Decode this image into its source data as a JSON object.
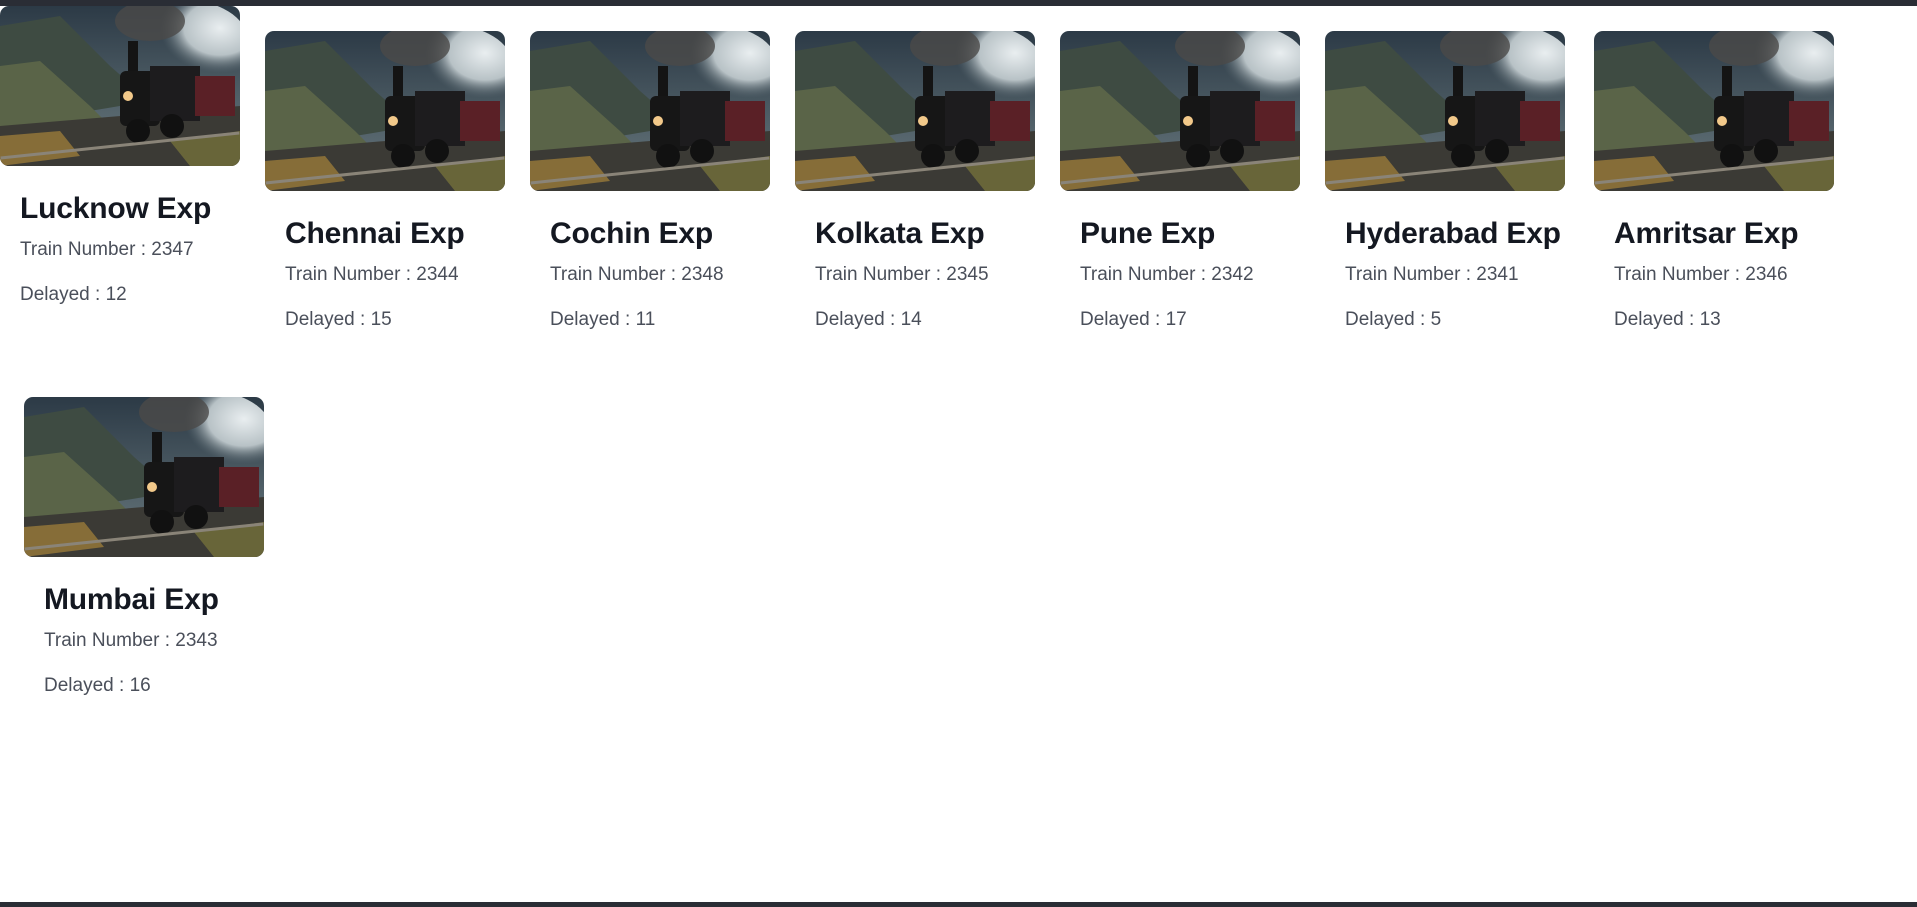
{
  "trains": [
    {
      "name": "Lucknow Exp",
      "number_label": "Train Number",
      "number": "2347",
      "delay_label": "Delayed",
      "delay": "12"
    },
    {
      "name": "Chennai Exp",
      "number_label": "Train Number",
      "number": "2344",
      "delay_label": "Delayed",
      "delay": "15"
    },
    {
      "name": "Cochin Exp",
      "number_label": "Train Number",
      "number": "2348",
      "delay_label": "Delayed",
      "delay": "11"
    },
    {
      "name": "Kolkata Exp",
      "number_label": "Train Number",
      "number": "2345",
      "delay_label": "Delayed",
      "delay": "14"
    },
    {
      "name": "Pune Exp",
      "number_label": "Train Number",
      "number": "2342",
      "delay_label": "Delayed",
      "delay": "17"
    },
    {
      "name": "Hyderabad Exp",
      "number_label": "Train Number",
      "number": "2341",
      "delay_label": "Delayed",
      "delay": "5"
    },
    {
      "name": "Amritsar Exp",
      "number_label": "Train Number",
      "number": "2346",
      "delay_label": "Delayed",
      "delay": "13"
    },
    {
      "name": "Mumbai Exp",
      "number_label": "Train Number",
      "number": "2343",
      "delay_label": "Delayed",
      "delay": "16"
    }
  ],
  "separator": " : ",
  "image": {
    "icon": "steam-locomotive-photo"
  },
  "colors": {
    "bar": "#2a2d35",
    "title": "#141821",
    "meta": "#4a4f5a"
  }
}
